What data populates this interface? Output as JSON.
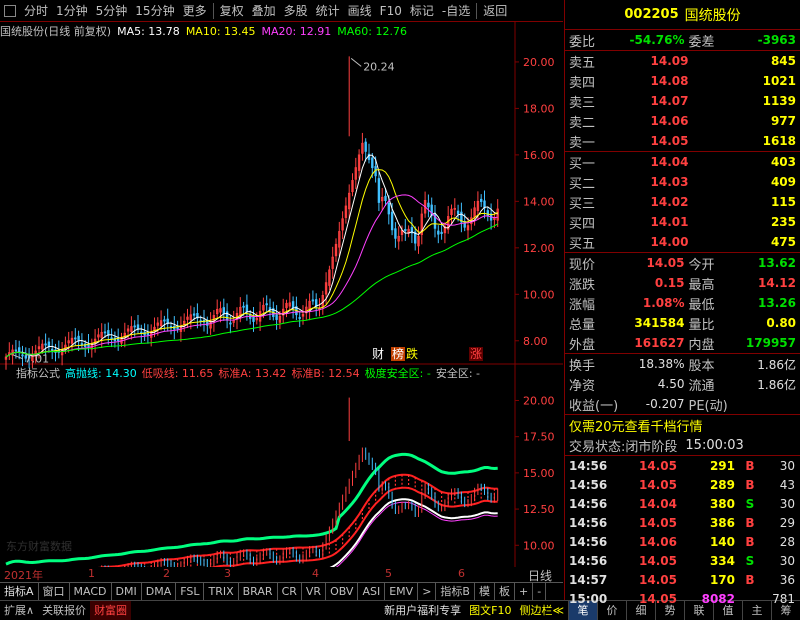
{
  "toolbar": {
    "items": [
      "分时",
      "1分钟",
      "5分钟",
      "15分钟",
      "更多",
      "复权",
      "叠加",
      "多股",
      "统计",
      "画线",
      "F10",
      "标记",
      "-自选",
      "返回"
    ]
  },
  "main_legend": {
    "name": "国统股份(日线 前复权)",
    "ma5": "MA5: 13.78",
    "ma10": "MA10: 13.45",
    "ma20": "MA20: 12.91",
    "ma60": "MA60: 12.76",
    "colors": {
      "ma5": "#ffffff",
      "ma10": "#ffff00",
      "ma20": "#ff40ff",
      "ma60": "#00ff00"
    }
  },
  "annotations": {
    "high": "20.24",
    "low": "7.01",
    "cai": "财",
    "bang": "榜",
    "die": "跌",
    "zhang": "涨"
  },
  "ind_legend": {
    "name": "指标公式",
    "high_line": "高抛线: 14.30",
    "low_line": "低吸线: 11.65",
    "std_a": "标准A: 13.42",
    "std_b": "标准B: 12.54",
    "safe1": "极度安全区: -",
    "safe2": "安全区: -"
  },
  "watermark": "东方财富数据",
  "time_axis": {
    "year": "2021年",
    "months": [
      "1",
      "2",
      "3",
      "4",
      "5",
      "6"
    ]
  },
  "timebar_right": "日线",
  "tabs": [
    "指标A",
    "窗口",
    "MACD",
    "DMI",
    "DMA",
    "FSL",
    "TRIX",
    "BRAR",
    "CR",
    "VR",
    "OBV",
    "ASI",
    "EMV",
    "指标B",
    "模",
    "板",
    "+",
    "-"
  ],
  "bottombar": {
    "left": [
      "扩展∧",
      "关联报价",
      "财富圈"
    ],
    "promo": "新用户福利专享",
    "f10": "图文F10",
    "sidebar": "侧边栏≪",
    "right_tabs": [
      "笔",
      "价",
      "细",
      "势",
      "联",
      "值",
      "主",
      "筹"
    ]
  },
  "stock": {
    "code": "002205",
    "name": "国统股份"
  },
  "weibi": {
    "label1": "委比",
    "v1": "-54.76%",
    "label2": "委差",
    "v2": "-3963"
  },
  "asks": [
    {
      "label": "卖五",
      "price": "14.09",
      "vol": "845"
    },
    {
      "label": "卖四",
      "price": "14.08",
      "vol": "1021"
    },
    {
      "label": "卖三",
      "price": "14.07",
      "vol": "1139"
    },
    {
      "label": "卖二",
      "price": "14.06",
      "vol": "977"
    },
    {
      "label": "卖一",
      "price": "14.05",
      "vol": "1618"
    }
  ],
  "bids": [
    {
      "label": "买一",
      "price": "14.04",
      "vol": "403"
    },
    {
      "label": "买二",
      "price": "14.03",
      "vol": "409"
    },
    {
      "label": "买三",
      "price": "14.02",
      "vol": "115"
    },
    {
      "label": "买四",
      "price": "14.01",
      "vol": "235"
    },
    {
      "label": "买五",
      "price": "14.00",
      "vol": "475"
    }
  ],
  "quote": [
    {
      "l1": "现价",
      "v1": "14.05",
      "c1": "red",
      "l2": "今开",
      "v2": "13.62",
      "c2": "green"
    },
    {
      "l1": "涨跌",
      "v1": "0.15",
      "c1": "red",
      "l2": "最高",
      "v2": "14.12",
      "c2": "red"
    },
    {
      "l1": "涨幅",
      "v1": "1.08%",
      "c1": "red",
      "l2": "最低",
      "v2": "13.26",
      "c2": "green"
    },
    {
      "l1": "总量",
      "v1": "341584",
      "c1": "yellow",
      "l2": "量比",
      "v2": "0.80",
      "c2": "yellow"
    },
    {
      "l1": "外盘",
      "v1": "161627",
      "c1": "red",
      "l2": "内盘",
      "v2": "179957",
      "c2": "green"
    }
  ],
  "fund": [
    {
      "l1": "换手",
      "v1": "18.38%",
      "l2": "股本",
      "v2": "1.86亿"
    },
    {
      "l1": "净资",
      "v1": "4.50",
      "l2": "流通",
      "v2": "1.86亿"
    },
    {
      "l1": "收益(一)",
      "v1": "-0.207",
      "l2": "PE(动)",
      "v2": ""
    }
  ],
  "promo_line": "仅需20元查看千档行情",
  "status": {
    "label": "交易状态:",
    "value": "闭市阶段",
    "time": "15:00:03"
  },
  "ticks": [
    {
      "t": "14:56",
      "p": "14.05",
      "v": "291",
      "bs": "B",
      "n": "30"
    },
    {
      "t": "14:56",
      "p": "14.05",
      "v": "289",
      "bs": "B",
      "n": "43"
    },
    {
      "t": "14:56",
      "p": "14.04",
      "v": "380",
      "bs": "S",
      "n": "30"
    },
    {
      "t": "14:56",
      "p": "14.05",
      "v": "386",
      "bs": "B",
      "n": "29"
    },
    {
      "t": "14:56",
      "p": "14.06",
      "v": "140",
      "bs": "B",
      "n": "28"
    },
    {
      "t": "14:56",
      "p": "14.05",
      "v": "334",
      "bs": "S",
      "n": "30"
    },
    {
      "t": "14:57",
      "p": "14.05",
      "v": "170",
      "bs": "B",
      "n": "36"
    },
    {
      "t": "15:00",
      "p": "14.05",
      "v": "8082",
      "bs": "",
      "n": "781"
    }
  ],
  "chart_data": {
    "type": "candlestick",
    "price_axis": {
      "ticks": [
        8.0,
        10.0,
        12.0,
        14.0,
        16.0,
        18.0,
        20.0
      ],
      "range": [
        7.0,
        20.6
      ]
    },
    "indicator_axis": {
      "ticks": [
        10.0,
        12.5,
        15.0,
        17.5,
        20.0
      ],
      "range": [
        8.5,
        21.0
      ]
    }
  }
}
